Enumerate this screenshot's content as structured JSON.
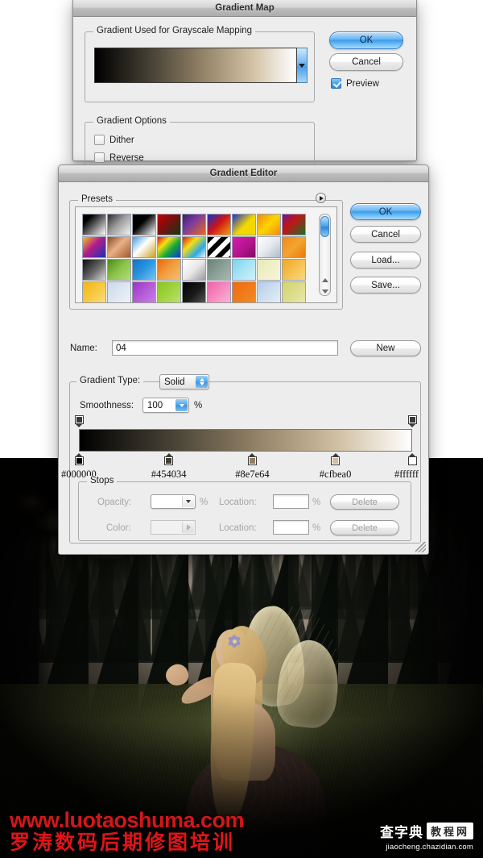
{
  "gradient_map_dialog": {
    "title": "Gradient Map",
    "group_gradient": {
      "label": "Gradient Used for Grayscale Mapping"
    },
    "group_options": {
      "label": "Gradient Options"
    },
    "dither_label": "Dither",
    "reverse_label": "Reverse",
    "dither_checked": false,
    "reverse_checked": false,
    "ok_label": "OK",
    "cancel_label": "Cancel",
    "preview_label": "Preview",
    "preview_checked": true,
    "preview_gradient_css": "linear-gradient(90deg,#000000 0%,#454034 27%,#8e7e64 52%,#cfbea0 77%,#ffffff 100%)"
  },
  "gradient_editor_dialog": {
    "title": "Gradient Editor",
    "presets_label": "Presets",
    "flyout_icon": "flyout-arrow-icon",
    "ok_label": "OK",
    "cancel_label": "Cancel",
    "load_label": "Load...",
    "save_label": "Save...",
    "new_label": "New",
    "name_label": "Name:",
    "name_value": "04",
    "gradient_type_label": "Gradient Type:",
    "gradient_type_value": "Solid",
    "smoothness_label": "Smoothness:",
    "smoothness_value": "100",
    "percent_sign": "%",
    "stops_label": "Stops",
    "opacity_label": "Opacity:",
    "opacity_value": "",
    "opacity_location_label": "Location:",
    "opacity_location_value": "",
    "color_label": "Color:",
    "color_location_label": "Location:",
    "color_location_value": "",
    "delete_label_opacity": "Delete",
    "delete_label_color": "Delete",
    "gradient_css": "linear-gradient(90deg,#000000 0%,#454034 27%,#8e7e64 52%,#cfbea0 77%,#ffffff 100%)",
    "color_stops": [
      {
        "hex": "#000000",
        "location_pct": 0
      },
      {
        "hex": "#454034",
        "location_pct": 27
      },
      {
        "hex": "#8e7e64",
        "location_pct": 52
      },
      {
        "hex": "#cfbea0",
        "location_pct": 77
      },
      {
        "hex": "#ffffff",
        "location_pct": 100
      }
    ],
    "opacity_stops": [
      {
        "location_pct": 0
      },
      {
        "location_pct": 100
      }
    ],
    "presets": [
      [
        "linear-gradient(135deg,#000 0%,#000 22%,#ffffff 100%)",
        "linear-gradient(135deg,#2b2b2b 0%,#9a9a9a 45%,rgba(255,255,255,0) 100%)",
        "linear-gradient(135deg,#000 0%,#000 40%,#ffffff 100%)",
        "linear-gradient(135deg,#c40000 0%,#7a0f0f 45%,#0f3a12 100%)",
        "linear-gradient(135deg,#3a1f6b 0%,#7a3aa0 40%,#e86a18 100%)",
        "linear-gradient(135deg,#1230c8 0%,#cf1414 48%,#f0a010 100%)",
        "linear-gradient(135deg,#1a2fd0 0%,#f3d800 55%,#f3d800 100%)",
        "linear-gradient(135deg,#f08a10 0%,#ffd400 50%,#f08a10 100%)",
        "linear-gradient(135deg,#6a1a8c 0%,#c41414 40%,#17702a 100%)"
      ],
      [
        "linear-gradient(135deg,#f6c21a 0%,#b21e8c 45%,#1a2fb4 100%)",
        "linear-gradient(135deg,#8a4a22 0%,#e8b089 45%,#a05a2c 100%)",
        "linear-gradient(135deg,#3aa0e8 0%,#ffffff 45%,#c9a020 100%)",
        "linear-gradient(135deg,#e01414 0%,#f3e014 30%,#14a83a 60%,#1436d8 100%)",
        "linear-gradient(135deg,#e01414 0%,#f3e014 35%,#2aa8e8 70%,rgba(255,255,255,0) 100%)",
        "repeating-linear-gradient(135deg,#000 0 6px,#fff 6px 12px)",
        "linear-gradient(135deg,#d41ab4 0%,#b4148c 55%,#7a1060 100%)",
        "linear-gradient(135deg,#ffffff 0%,#e4e9ee 50%,#aebcc8 100%)",
        "linear-gradient(135deg,#f08a10 0%,#f3a433 50%,#e87a08 100%)"
      ],
      [
        "linear-gradient(135deg,#0a0a0a 0%,#6a6a6a 55%,#d8d8d8 100%)",
        "linear-gradient(135deg,#4a8a1a 0%,#8cc44a 50%,#b4dc7a 100%)",
        "linear-gradient(135deg,#1470c4 0%,#2a96e0 50%,#7ac4f0 100%)",
        "linear-gradient(135deg,#e86a10 0%,#f0a040 50%,#f3c070 100%)",
        "linear-gradient(135deg,#ffffff 0%,#e8e8e8 50%,#9a9a9a 100%)",
        "linear-gradient(135deg,#6a8078 0%,#8aa096 50%,#aab8b0 100%)",
        "linear-gradient(135deg,#7ad4f0 0%,#a8e4f6 50%,#d0f0fb 100%)",
        "linear-gradient(135deg,#e8eab4 0%,#f0f0c8 50%,#f6f6dc 100%)",
        "linear-gradient(135deg,#f0a820 0%,#f6c050 50%,#fad880 100%)"
      ],
      [
        "linear-gradient(135deg,#f3b410 0%,#f6c840 50%,#fadc7a 100%)",
        "linear-gradient(135deg,#ccd8e8 0%,#dde6f0 50%,#eef2f8 100%)",
        "linear-gradient(135deg,#9a34c4 0%,#b45ad8 50%,#c880e8 100%)",
        "linear-gradient(135deg,#8ac420 0%,#a0d440 50%,#b8e070 100%)",
        "linear-gradient(135deg,#000000 0%,#1a1a1a 55%,#555555 100%)",
        "linear-gradient(135deg,#f060a8 0%,#f68ac0 50%,#fab4d4 100%)",
        "linear-gradient(135deg,#f06a10 0%,#f07a18 50%,#f08a28 100%)",
        "linear-gradient(135deg,#b4cce8 0%,#cddef0 50%,#e4eef8 100%)",
        "linear-gradient(135deg,#d4d46a 0%,#dcdc8a 50%,#e8e8aa 100%)"
      ]
    ]
  },
  "photo": {
    "watermark_url": "www.luotaoshuma.com",
    "watermark_cn": "罗涛数码后期修图培训",
    "logo_cn": "查字典",
    "logo_box": "教程网",
    "logo_url": "jiaocheng.chazidian.com"
  }
}
